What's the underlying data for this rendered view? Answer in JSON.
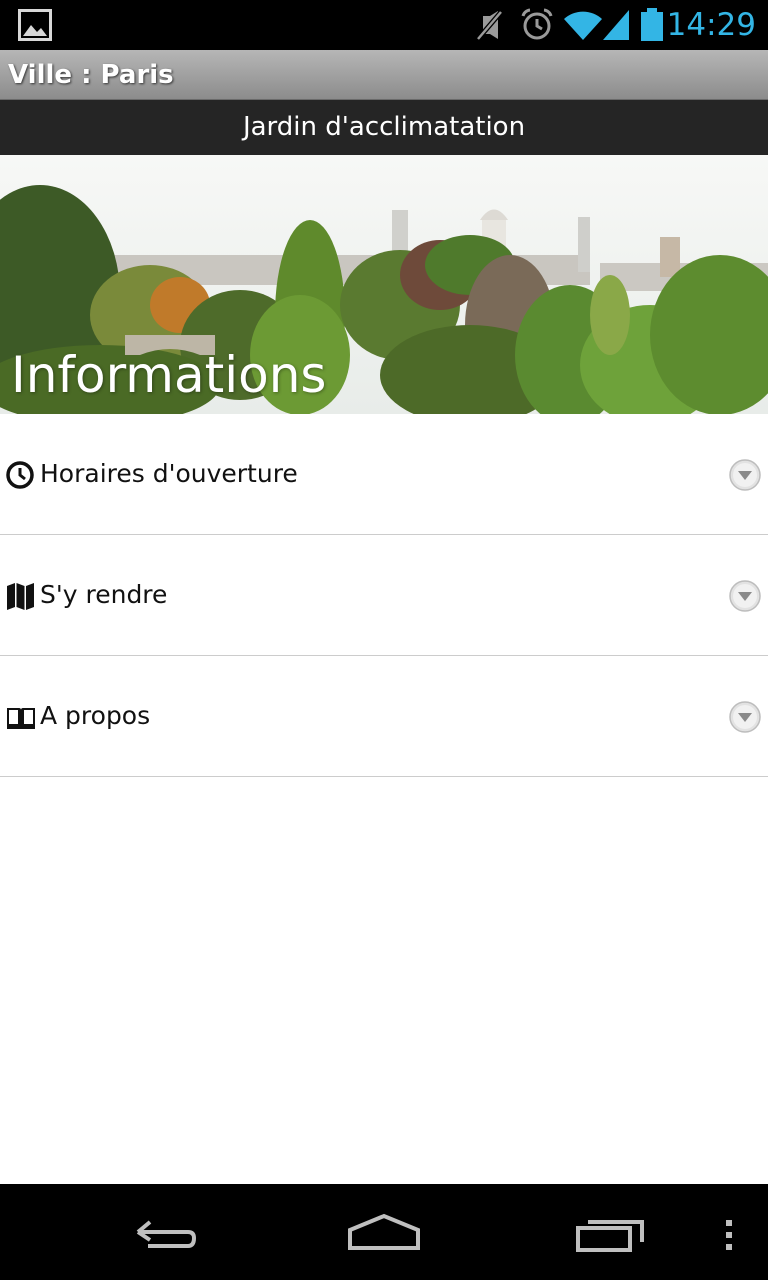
{
  "status_bar": {
    "time": "14:29",
    "notification_icon": "image-icon",
    "icons": [
      "mute-icon",
      "alarm-icon",
      "wifi-icon",
      "signal-icon",
      "battery-icon"
    ],
    "accent_color": "#33b5e5"
  },
  "title_bar": {
    "title": "Ville : Paris"
  },
  "header": {
    "title": "Jardin d'acclimatation"
  },
  "hero": {
    "title": "Informations"
  },
  "menu": {
    "items": [
      {
        "label": "Horaires d'ouverture",
        "icon": "clock-icon",
        "expanded": false
      },
      {
        "label": "S'y rendre",
        "icon": "map-icon",
        "expanded": false
      },
      {
        "label": "A propos",
        "icon": "book-icon",
        "expanded": false
      }
    ]
  },
  "nav_bar": {
    "buttons": [
      "back-icon",
      "home-icon",
      "recent-apps-icon",
      "menu-overflow-icon"
    ]
  }
}
